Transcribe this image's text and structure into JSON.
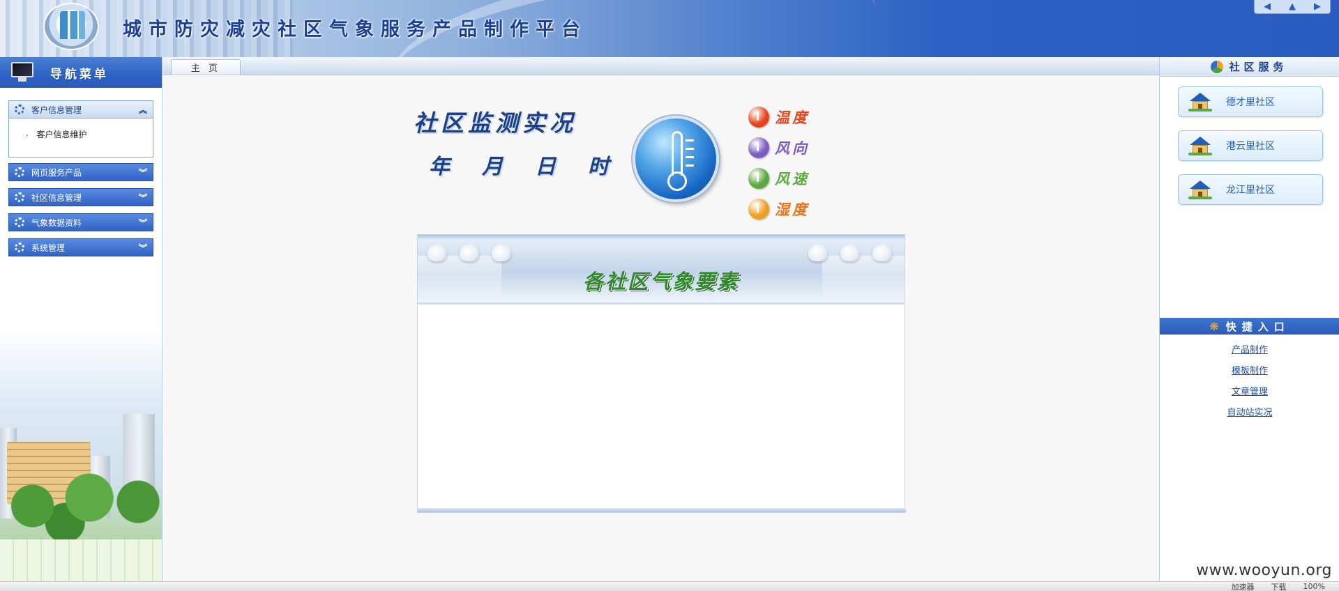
{
  "header": {
    "title": "城市防灾减灾社区气象服务产品制作平台",
    "nav_buttons": [
      "◀",
      "▲",
      "▶"
    ]
  },
  "sidebar": {
    "title": "导航菜单",
    "groups": [
      {
        "label": "客户信息管理",
        "state": "expanded",
        "items": [
          "客户信息维护"
        ]
      },
      {
        "label": "网页服务产品",
        "state": "collapsed"
      },
      {
        "label": "社区信息管理",
        "state": "collapsed"
      },
      {
        "label": "气象数据资料",
        "state": "collapsed"
      },
      {
        "label": "系统管理",
        "state": "collapsed"
      }
    ]
  },
  "tabs": [
    {
      "label": "主 页",
      "active": true
    }
  ],
  "monitor": {
    "title": "社区监测实况",
    "date_parts": [
      "年",
      "月",
      "日",
      "时"
    ],
    "legend": [
      {
        "label": "温度",
        "color": "#e8441c",
        "text_color": "#e8441c"
      },
      {
        "label": "风向",
        "color": "#7d5cc2",
        "text_color": "#7d5cc2"
      },
      {
        "label": "风速",
        "color": "#5aa83e",
        "text_color": "#5aa83e"
      },
      {
        "label": "湿度",
        "color": "#f0a020",
        "text_color": "#e8741c"
      }
    ]
  },
  "elements_panel": {
    "title": "各社区气象要素"
  },
  "right_panel": {
    "community_title": "社区服务",
    "communities": [
      "德才里社区",
      "港云里社区",
      "龙江里社区"
    ],
    "quick_title": "快捷入口",
    "quick_links": [
      "产品制作",
      "模板制作",
      "文章管理",
      "自动站实况"
    ]
  },
  "statusbar": {
    "items": [
      "加速器",
      "下载",
      "100%"
    ]
  },
  "watermark": "www.wooyun.org"
}
